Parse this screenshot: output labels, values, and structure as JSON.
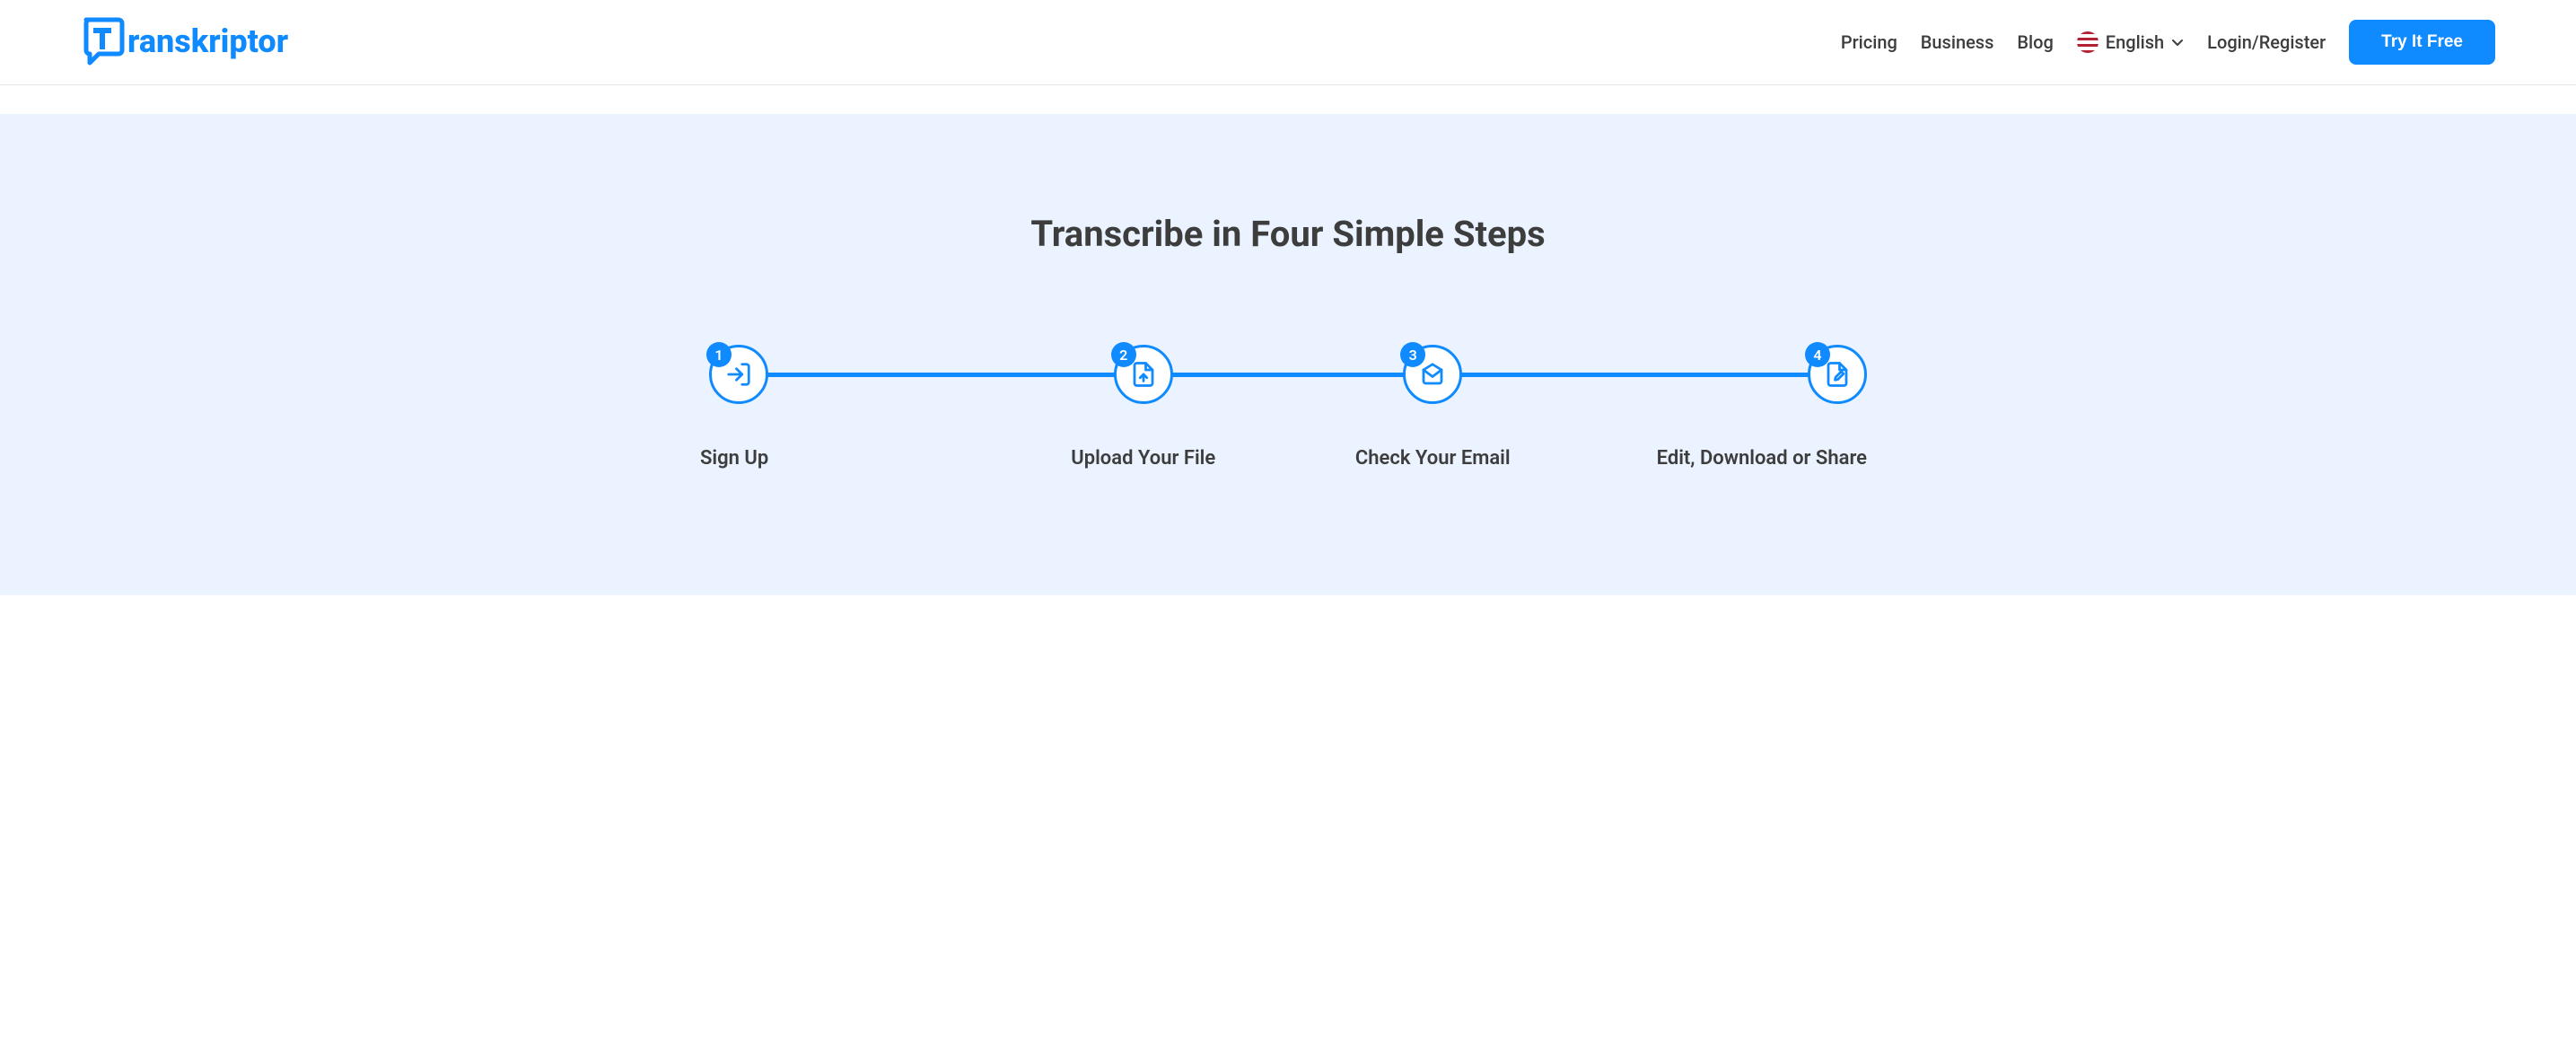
{
  "brand": "Transkriptor",
  "nav": {
    "pricing": "Pricing",
    "business": "Business",
    "blog": "Blog",
    "language": "English",
    "login": "Login/Register",
    "cta": "Try It Free"
  },
  "hero": {
    "title": "Transcribe in Four Simple Steps"
  },
  "steps": [
    {
      "num": "1",
      "label": "Sign Up"
    },
    {
      "num": "2",
      "label": "Upload Your File"
    },
    {
      "num": "3",
      "label": "Check Your Email"
    },
    {
      "num": "4",
      "label": "Edit, Download or Share"
    }
  ]
}
